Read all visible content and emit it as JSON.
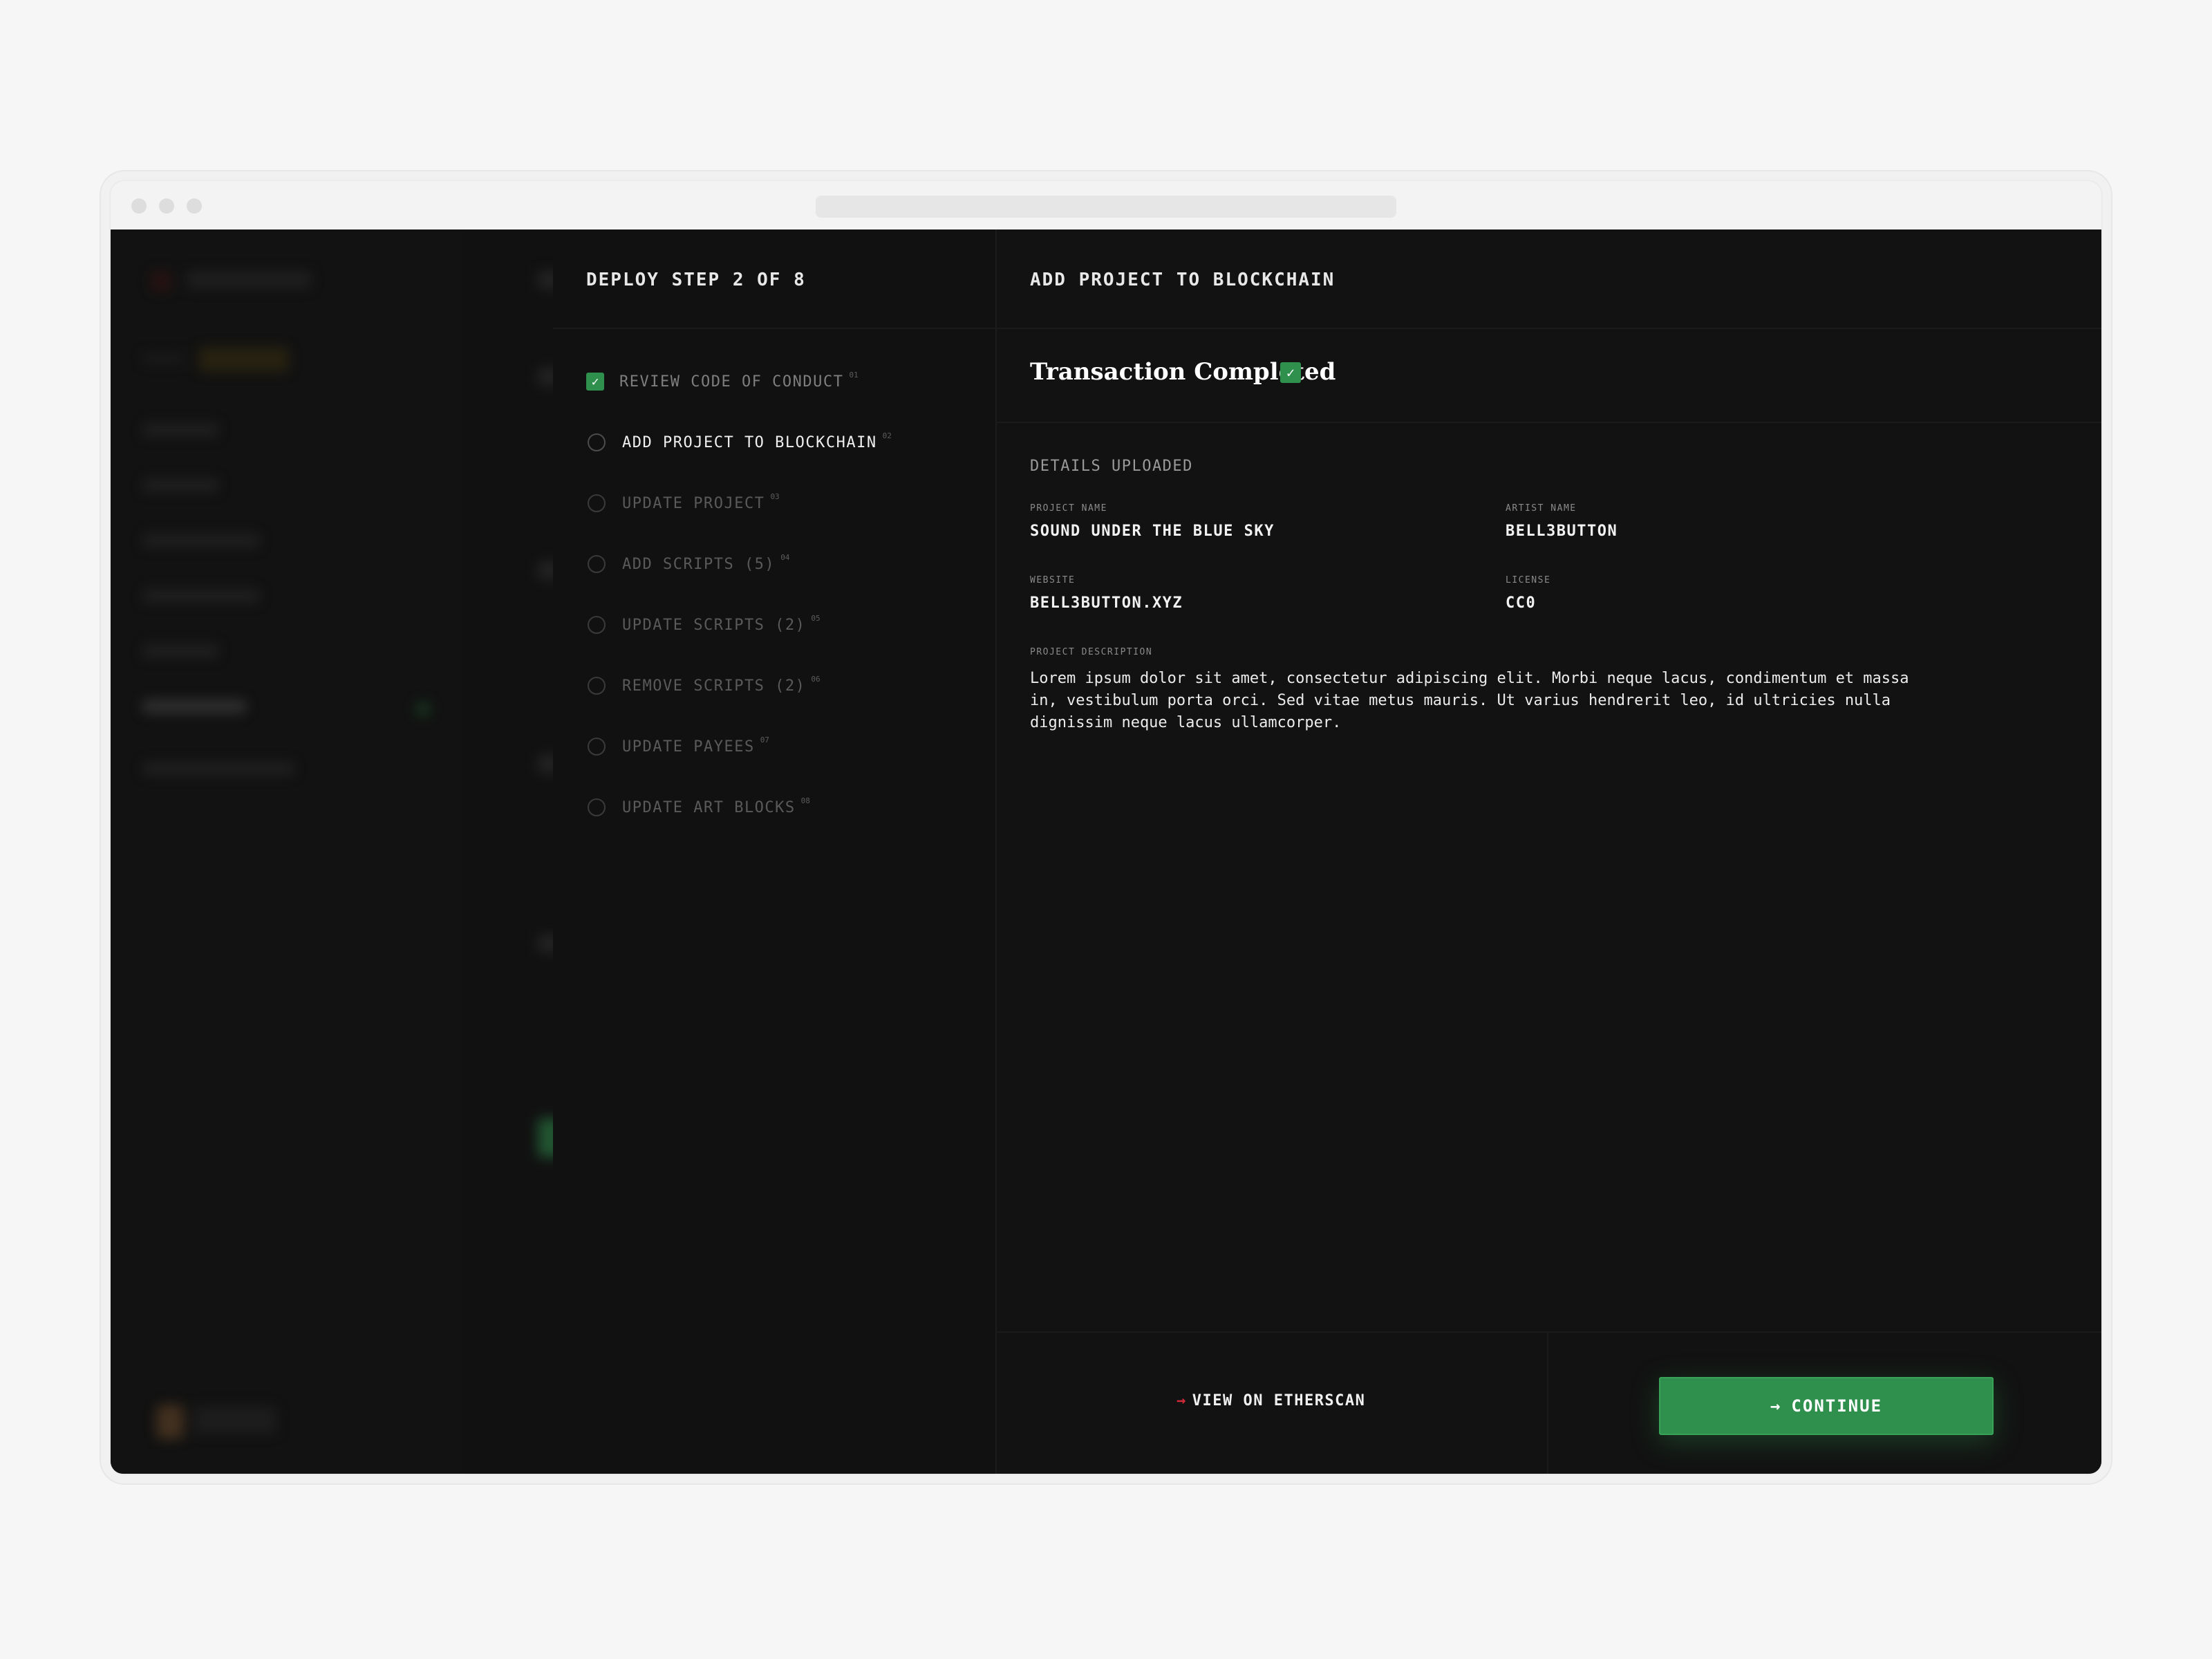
{
  "wizard": {
    "steps_title": "DEPLOY STEP 2 OF 8",
    "steps": [
      {
        "label": "REVIEW CODE OF CONDUCT",
        "num": "01",
        "status": "done"
      },
      {
        "label": "ADD PROJECT TO BLOCKCHAIN",
        "num": "02",
        "status": "current"
      },
      {
        "label": "UPDATE PROJECT",
        "num": "03",
        "status": "pending"
      },
      {
        "label": "ADD SCRIPTS (5)",
        "num": "04",
        "status": "pending"
      },
      {
        "label": "UPDATE SCRIPTS (2)",
        "num": "05",
        "status": "pending"
      },
      {
        "label": "REMOVE SCRIPTS (2)",
        "num": "06",
        "status": "pending"
      },
      {
        "label": "UPDATE PAYEES",
        "num": "07",
        "status": "pending"
      },
      {
        "label": "UPDATE ART BLOCKS",
        "num": "08",
        "status": "pending"
      }
    ]
  },
  "detail": {
    "title": "ADD PROJECT TO BLOCKCHAIN",
    "close_icon": "×",
    "transaction_title": "Transaction Completed",
    "check_icon": "✓",
    "section_title": "DETAILS UPLOADED",
    "fields": {
      "project_name_label": "PROJECT NAME",
      "project_name": "SOUND UNDER THE BLUE SKY",
      "artist_name_label": "ARTIST NAME",
      "artist_name": "BELL3BUTTON",
      "website_label": "WEBSITE",
      "website": "BELL3BUTTON.XYZ",
      "license_label": "LICENSE",
      "license": "CC0",
      "description_label": "PROJECT DESCRIPTION",
      "description": "Lorem ipsum dolor sit amet, consectetur adipiscing elit. Morbi neque lacus, condimentum et massa in, vestibulum porta orci. Sed vitae metus mauris. Ut varius hendrerit leo, id ultricies nulla dignissim neque lacus ullamcorper."
    }
  },
  "footer": {
    "etherscan_label": "VIEW ON ETHERSCAN",
    "continue_label": "CONTINUE",
    "arrow_icon": "→"
  },
  "colors": {
    "accent_green": "#2f8f4c",
    "accent_red": "#d32a3a",
    "panel_bg": "#121212"
  }
}
